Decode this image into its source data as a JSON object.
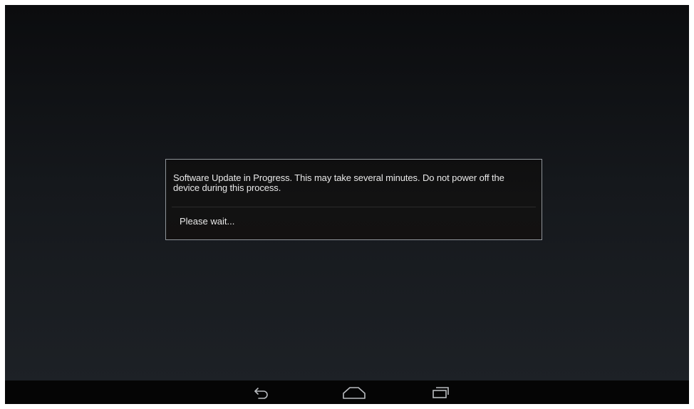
{
  "dialog": {
    "message": "Software Update in Progress. This may take several minutes. Do not power off the device during this process.",
    "status": "Please wait..."
  },
  "navigation_bar": {
    "buttons": [
      {
        "name": "back",
        "icon": "back-arrow-icon"
      },
      {
        "name": "home",
        "icon": "home-icon"
      },
      {
        "name": "recents",
        "icon": "recent-apps-icon"
      }
    ]
  },
  "colors": {
    "background_top": "#0b0c0e",
    "background_bottom": "#1e2227",
    "dialog_border": "#8f9499",
    "text": "#e9e9e9",
    "navbar": "#050505"
  }
}
